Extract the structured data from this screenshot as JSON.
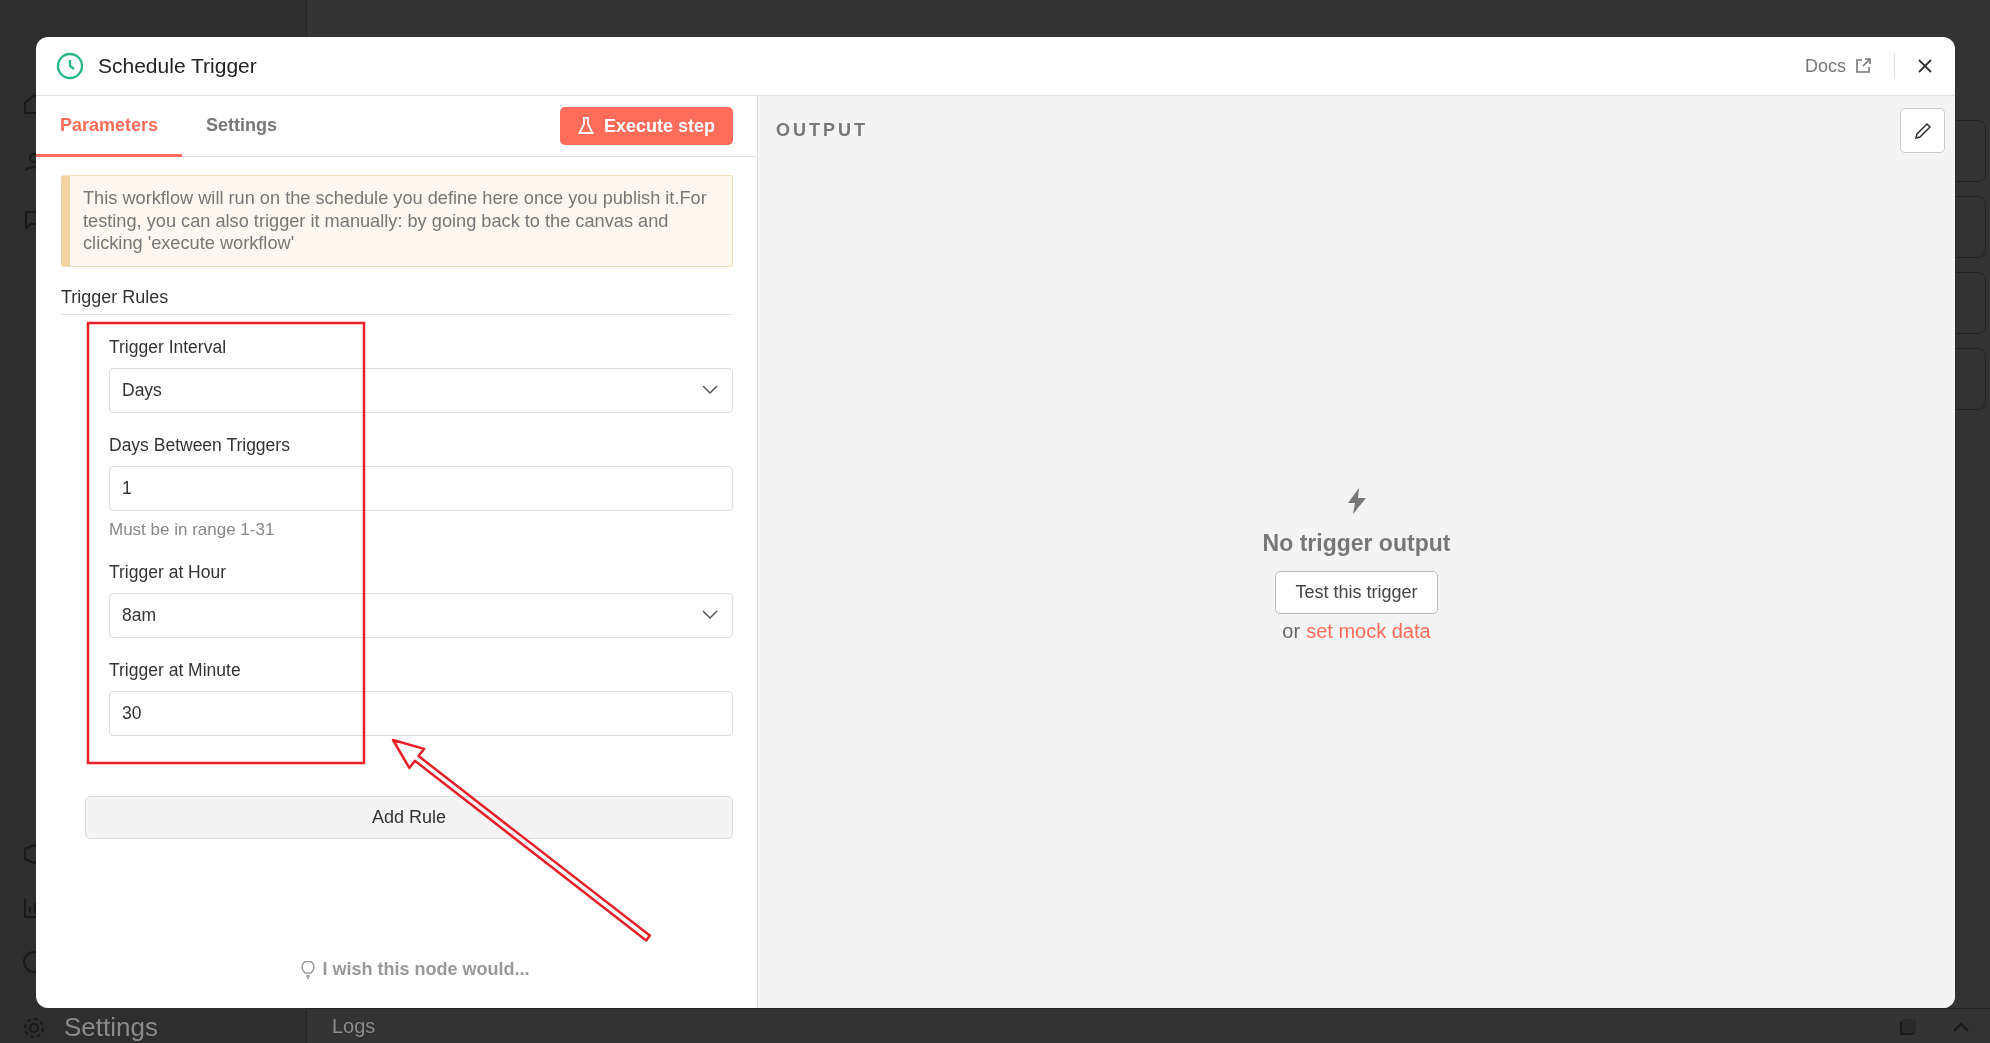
{
  "background": {
    "sidebar_items": [
      {
        "label": "Settings"
      }
    ],
    "logs_panel": {
      "title": "Logs"
    }
  },
  "modal": {
    "title": "Schedule Trigger",
    "docs_link": "Docs",
    "tabs": [
      {
        "label": "Parameters",
        "selected": true
      },
      {
        "label": "Settings",
        "selected": false
      }
    ],
    "execute_button": "Execute step",
    "notice": "This workflow will run on the schedule you define here once you publish it.For testing, you can also trigger it manually: by going back to the canvas and clicking 'execute workflow'",
    "section_title": "Trigger Rules",
    "fields": [
      {
        "kind": "select",
        "label": "Trigger Interval",
        "value": "Days"
      },
      {
        "kind": "input",
        "label": "Days Between Triggers",
        "value": "1",
        "hint": "Must be in range 1-31"
      },
      {
        "kind": "select",
        "label": "Trigger at Hour",
        "value": "8am"
      },
      {
        "kind": "input",
        "label": "Trigger at Minute",
        "value": "30"
      }
    ],
    "add_button": "Add Rule",
    "feedback_link": "I wish this node would...",
    "output": {
      "title": "OUTPUT",
      "empty_title": "No trigger output",
      "test_button": "Test this trigger",
      "alt_prefix": "or",
      "alt_link": "set mock data"
    }
  }
}
